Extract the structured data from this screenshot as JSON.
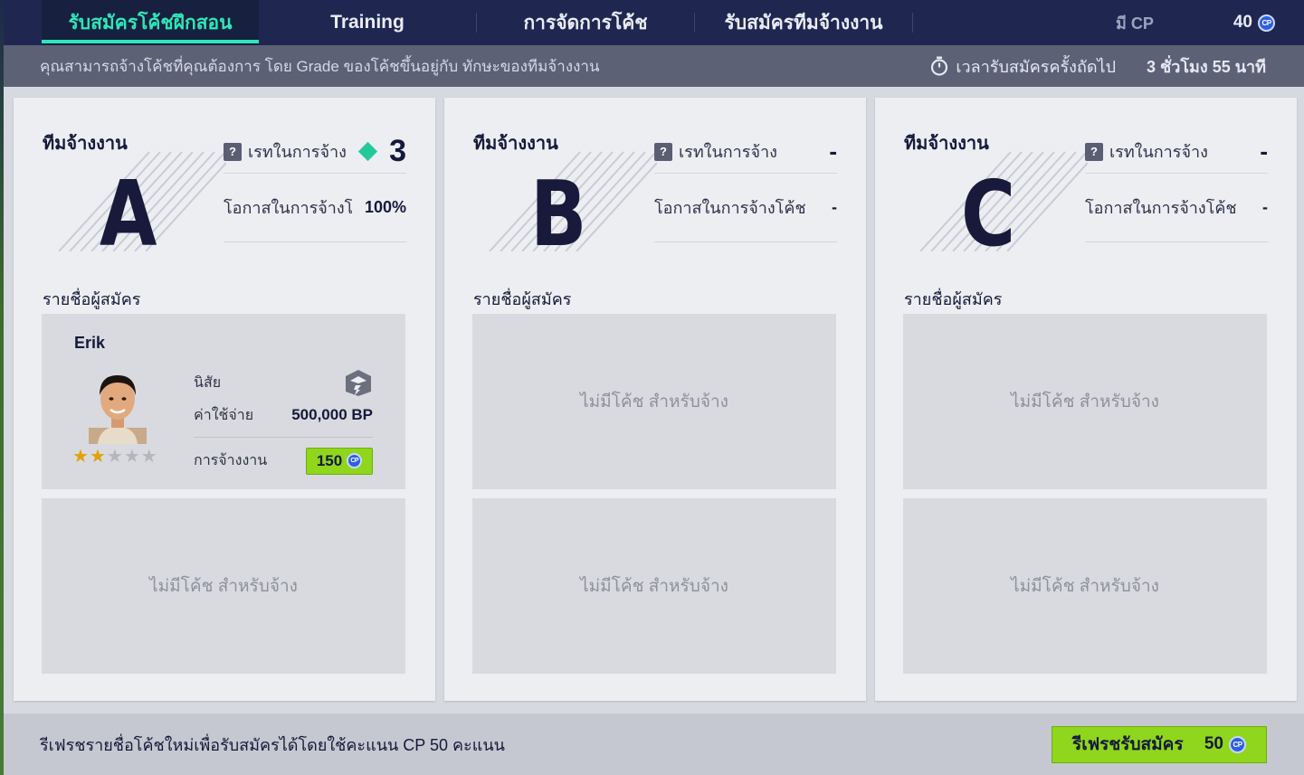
{
  "nav": {
    "tabs": [
      {
        "label": "รับสมัครโค้ชฝึกสอน",
        "active": true
      },
      {
        "label": "Training",
        "active": false
      },
      {
        "label": "การจัดการโค้ช",
        "active": false
      },
      {
        "label": "รับสมัครทีมจ้างงาน",
        "active": false
      }
    ],
    "cp_label": "มี CP",
    "cp_value": "40",
    "coin_label": "CP"
  },
  "subbar": {
    "description": "คุณสามารถจ้างโค้ชที่คุณต้องการ โดย Grade ของโค้ชขึ้นอยู่กับ ทักษะของทีมจ้างงาน",
    "timer_label": "เวลารับสมัครครั้งถัดไป",
    "timer_value": "3 ชั่วโมง 55 นาที"
  },
  "cards": [
    {
      "team_label": "ทีมจ้างงาน",
      "grade_letter": "A",
      "grade_label": "เรทในการจ้าง",
      "grade_value": "3",
      "chance_label": "โอกาสในการจ้างโค้ช",
      "chance_value": "100%",
      "list_title": "รายชื่อผู้สมัคร",
      "slots": [
        {
          "filled": true,
          "coach": {
            "name": "Erik",
            "stars_on": 2,
            "stars_total": 5,
            "personality_label": "นิสัย",
            "cost_label": "ค่าใช้จ่าย",
            "cost_value": "500,000 BP",
            "hire_label": "การจ้างงาน",
            "hire_cost": "150"
          }
        },
        {
          "filled": false,
          "empty_text": "ไม่มีโค้ช สำหรับจ้าง"
        }
      ]
    },
    {
      "team_label": "ทีมจ้างงาน",
      "grade_letter": "B",
      "grade_label": "เรทในการจ้าง",
      "grade_value": "-",
      "chance_label": "โอกาสในการจ้างโค้ช",
      "chance_value": "-",
      "list_title": "รายชื่อผู้สมัคร",
      "slots": [
        {
          "filled": false,
          "empty_text": "ไม่มีโค้ช สำหรับจ้าง"
        },
        {
          "filled": false,
          "empty_text": "ไม่มีโค้ช สำหรับจ้าง"
        }
      ]
    },
    {
      "team_label": "ทีมจ้างงาน",
      "grade_letter": "C",
      "grade_label": "เรทในการจ้าง",
      "grade_value": "-",
      "chance_label": "โอกาสในการจ้างโค้ช",
      "chance_value": "-",
      "list_title": "รายชื่อผู้สมัคร",
      "slots": [
        {
          "filled": false,
          "empty_text": "ไม่มีโค้ช สำหรับจ้าง"
        },
        {
          "filled": false,
          "empty_text": "ไม่มีโค้ช สำหรับจ้าง"
        }
      ]
    }
  ],
  "footer": {
    "text": "รีเฟรชรายชื่อโค้ชใหม่เพื่อรับสมัครได้โดยใช้คะแนน CP 50 คะแนน",
    "button_label": "รีเฟรชรับสมัคร",
    "button_cost": "50"
  },
  "colors": {
    "nav_bg": "#1f2750",
    "accent": "#2fe6b8",
    "button_green": "#8fd61c",
    "diamond": "#24c99a",
    "coin_blue": "#2e5fe0"
  },
  "icons": [
    "help-icon",
    "diamond-icon",
    "cp-coin-icon",
    "stopwatch-icon",
    "personality-icon",
    "star-icon"
  ]
}
